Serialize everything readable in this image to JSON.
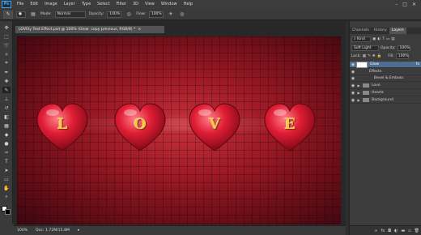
{
  "menubar": {
    "logo": "Ps",
    "items": [
      "File",
      "Edit",
      "Image",
      "Layer",
      "Type",
      "Select",
      "Filter",
      "3D",
      "View",
      "Window",
      "Help"
    ],
    "controls": [
      "–",
      "□",
      "✕"
    ]
  },
  "options": {
    "mode_label": "Mode:",
    "mode_value": "Normal",
    "opacity_label": "Opacity:",
    "opacity_value": "100%",
    "flow_label": "Flow:",
    "flow_value": "100%"
  },
  "document": {
    "tab_title": "LOVEly Text Effect.psd @ 100% (Glow",
    "tab_title_rest": "copy previous, RGB/8) *",
    "letters": [
      "L",
      "O",
      "V",
      "E"
    ],
    "colors": {
      "background": "#9e1a26",
      "heart": "#e01d35",
      "letter": "#f3c64c"
    }
  },
  "status": {
    "zoom": "100%",
    "doc_info": "Doc: 1.72M/15.8M"
  },
  "panel": {
    "tabs": [
      "Channels",
      "History",
      "Layers"
    ],
    "active_tab": "Layers",
    "kind_label": "Kind",
    "blend_mode": "Soft Light",
    "opacity_label": "Opacity:",
    "opacity_value": "100%",
    "lock_label": "Lock:",
    "fill_label": "Fill:",
    "fill_value": "100%",
    "layers": [
      {
        "name": "Glow",
        "selected": true,
        "type": "layer"
      },
      {
        "name": "Effects",
        "type": "effects"
      },
      {
        "name": "Bevel & Emboss",
        "type": "effect"
      },
      {
        "name": "Love",
        "type": "group"
      },
      {
        "name": "Hearts",
        "type": "group"
      },
      {
        "name": "Background",
        "type": "group"
      }
    ]
  }
}
